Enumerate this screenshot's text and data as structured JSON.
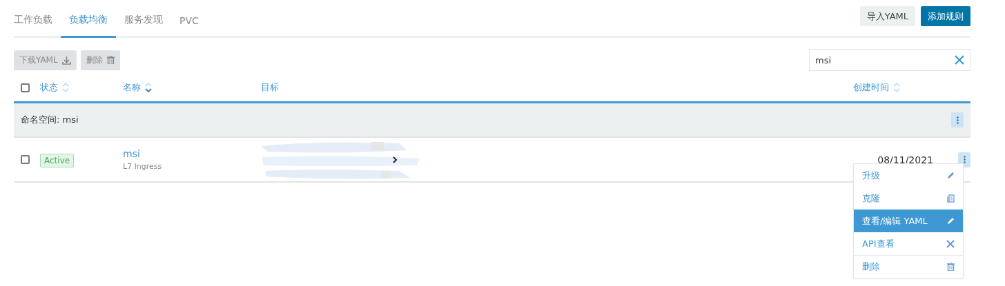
{
  "tabs": [
    {
      "label": "工作负载",
      "selected": false
    },
    {
      "label": "负载均衡",
      "selected": true
    },
    {
      "label": "服务发现",
      "selected": false
    },
    {
      "label": "PVC",
      "selected": false
    }
  ],
  "header_buttons": [
    {
      "label": "导入YAML",
      "kind": "secondary"
    },
    {
      "label": "添加规则",
      "kind": "primary"
    }
  ],
  "toolbar": [
    {
      "label": "下载YAML",
      "kind": "download",
      "disabled": true
    },
    {
      "label": "删除",
      "kind": "trash",
      "disabled": true
    }
  ],
  "search": {
    "value": "msi"
  },
  "table": {
    "select_all_checked": false,
    "columns": [
      {
        "label": "状态",
        "sortable": true,
        "sorted": false
      },
      {
        "label": "名称",
        "sortable": true,
        "sorted": true
      },
      {
        "label": "目标"
      },
      {
        "label": "创建时间",
        "sortable": true,
        "sorted": false
      }
    ],
    "groups": [
      {
        "label": "命名空间: msi",
        "rows": [
          {
            "checked": false,
            "status": "Active",
            "name": "msi",
            "type": "L7 Ingress",
            "created": "08/11/2021"
          }
        ]
      }
    ]
  },
  "action_menu": {
    "items": [
      {
        "label": "升级",
        "kind": "pencil",
        "selected": false,
        "divider": false
      },
      {
        "label": "克隆",
        "kind": "copy",
        "selected": false,
        "divider": false
      },
      {
        "label": "查看/编辑 YAML",
        "kind": "pencil",
        "selected": true,
        "divider": false
      },
      {
        "label": "API查看",
        "kind": "tools",
        "selected": false,
        "divider": false
      },
      {
        "label": "删除",
        "kind": "trash",
        "selected": false,
        "divider": true
      }
    ]
  }
}
